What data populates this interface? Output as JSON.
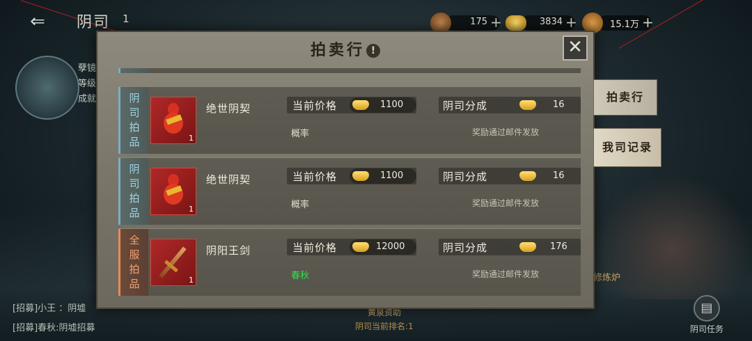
{
  "topbar": {
    "back_label": "⇐",
    "title": "阴司",
    "count": "1",
    "resources": [
      {
        "icon": "jade-coin-icon",
        "value": "175",
        "color": "#8a5a30"
      },
      {
        "icon": "gold-ingot-icon",
        "value": "3834",
        "color": "#e0b030"
      },
      {
        "icon": "copper-coin-icon",
        "value": "15.1万",
        "color": "#c07a30"
      }
    ],
    "plus": "+"
  },
  "side": {
    "text_lines": [
      "孽镜",
      "等级",
      "成就"
    ]
  },
  "chat": [
    "[招募]小王 ：阴墟",
    "[招募]春秋:阴墟招募"
  ],
  "bottom": {
    "title": "黄泉资助",
    "sub": "阴司当前排名:1"
  },
  "right": {
    "refine_label": "修炼炉",
    "task_label": "阴司任务",
    "task_icon": "scroll-icon"
  },
  "dialog": {
    "title": "拍卖行",
    "info_icon": "!",
    "close_label": "✕",
    "tabs": [
      "拍卖行",
      "我司记录"
    ],
    "price_label": "当前价格",
    "share_label": "阴司分成",
    "mail_note": "奖励通过邮件发放",
    "rows": [
      {
        "tag": [
          "阴",
          "司",
          "拍",
          "品"
        ],
        "tag_type": "yinsi",
        "name": "绝世阴契",
        "qty": "1",
        "price": "1100",
        "share": "16",
        "rate": "概率",
        "item_icon": "red-gourd-icon"
      },
      {
        "tag": [
          "阴",
          "司",
          "拍",
          "品"
        ],
        "tag_type": "yinsi",
        "name": "绝世阴契",
        "qty": "1",
        "price": "1100",
        "share": "16",
        "rate": "概率",
        "item_icon": "red-gourd-icon"
      },
      {
        "tag": [
          "全",
          "服",
          "拍",
          "品"
        ],
        "tag_type": "server",
        "name": "阴阳王剑",
        "qty": "1",
        "price": "12000",
        "share": "176",
        "rate": "春秋",
        "item_icon": "sword-icon"
      }
    ]
  },
  "colors": {
    "tag_yinsi": "#9fd4e6",
    "tag_server": "#f2a070",
    "rate_highlight": "#30e050"
  }
}
